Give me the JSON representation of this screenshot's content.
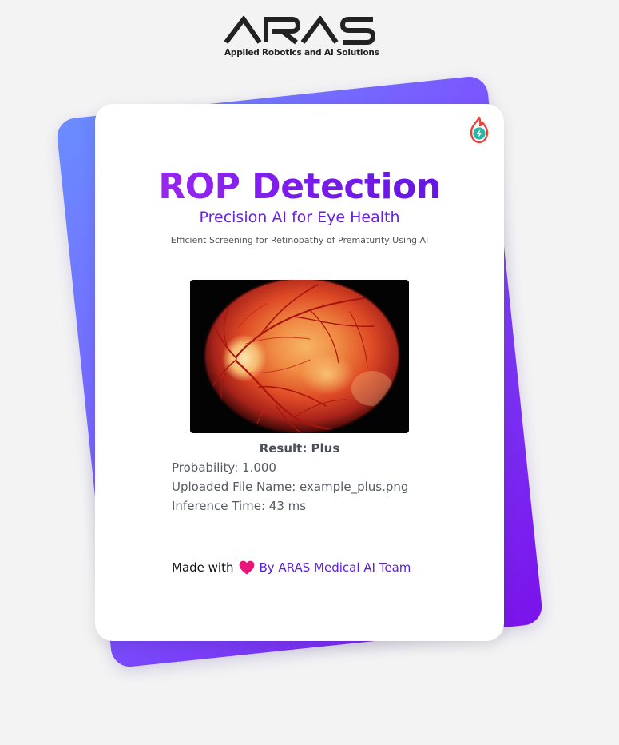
{
  "logo": {
    "wordmark": "ARAS",
    "tagline": "Applied Robotics and AI Solutions"
  },
  "card": {
    "title": "ROP Detection",
    "subtitle": "Precision AI for Eye Health",
    "tagline": "Efficient Screening for Retinopathy of Prematurity Using AI",
    "icon": "flame-bolt-icon",
    "image_alt": "retina fundus image"
  },
  "result": {
    "title": "Result: Plus",
    "probability": "Probability: 1.000",
    "file_name": "Uploaded File Name: example_plus.png",
    "inference_time": "Inference Time: 43 ms"
  },
  "footer": {
    "made_with": "Made with",
    "heart_icon": "heart-icon",
    "team": "By ARAS Medical AI Team"
  },
  "colors": {
    "accent_purple": "#7a1cec",
    "accent_blue": "#6a8dff",
    "heart_pink": "#e8157a",
    "icon_red": "#e8423a",
    "icon_teal": "#2eb6a7"
  }
}
